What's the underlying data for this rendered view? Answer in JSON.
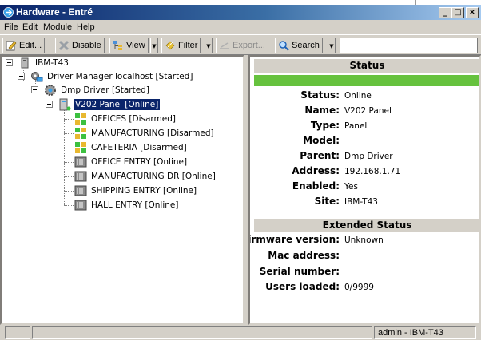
{
  "window": {
    "title": "Hardware - Entré"
  },
  "menu": [
    "File",
    "Edit",
    "Module",
    "Help"
  ],
  "toolbar": {
    "edit": "Edit...",
    "disable": "Disable",
    "view": "View",
    "filter": "Filter",
    "export": "Export...",
    "search": "Search",
    "search_value": ""
  },
  "tree": {
    "root": "IBM-T43",
    "manager": "Driver Manager localhost [Started]",
    "driver": "Dmp Driver [Started]",
    "panel": "V202 Panel [Online]",
    "children": [
      "OFFICES [Disarmed]",
      "MANUFACTURING [Disarmed]",
      "CAFETERIA [Disarmed]",
      "OFFICE ENTRY [Online]",
      "MANUFACTURING DR [Online]",
      "SHIPPING ENTRY [Online]",
      "HALL ENTRY [Online]"
    ]
  },
  "details": {
    "status_header": "Status",
    "status_color": "#66c23e",
    "rows": [
      {
        "key": "Status:",
        "value": "Online"
      },
      {
        "key": "Name:",
        "value": "V202 Panel"
      },
      {
        "key": "Type:",
        "value": "Panel"
      },
      {
        "key": "Model:",
        "value": ""
      },
      {
        "key": "Parent:",
        "value": "Dmp Driver"
      },
      {
        "key": "Address:",
        "value": "192.168.1.71"
      },
      {
        "key": "Enabled:",
        "value": "Yes"
      },
      {
        "key": "Site:",
        "value": "IBM-T43"
      }
    ],
    "extended_header": "Extended Status",
    "ext_rows": [
      {
        "key": "Firmware version:",
        "value": "Unknown"
      },
      {
        "key": "Mac address:",
        "value": ""
      },
      {
        "key": "Serial number:",
        "value": ""
      },
      {
        "key": "Users loaded:",
        "value": "0/9999"
      }
    ]
  },
  "statusbar": {
    "user": "admin - IBM-T43"
  }
}
